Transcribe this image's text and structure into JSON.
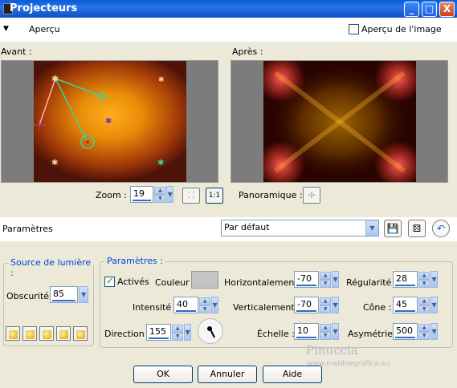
{
  "window": {
    "title": "Projecteurs",
    "minimize": "_",
    "maximize": "□",
    "close": "X"
  },
  "preview_bar": {
    "toggle_glyph": "▼",
    "label": "Aperçu",
    "apercu_image_label": "Aperçu de l'image"
  },
  "avant_label": "Avant :",
  "apres_label": "Après :",
  "zoom": {
    "label": "Zoom :",
    "value": "19",
    "fit_btn": "⛶",
    "one_to_one_btn": "1:1"
  },
  "panoramique": {
    "label": "Panoramique :",
    "glyph": "✢"
  },
  "parametres_row": {
    "label": "Paramètres",
    "preset": "Par défaut",
    "save_glyph": "💾",
    "dice_glyph": "⚄",
    "reset_glyph": "↶"
  },
  "source_lumiere": {
    "title": "Source de lumière :",
    "obscurite_label": "Obscurité :",
    "obscurite_value": "85"
  },
  "parametres_group": {
    "title": "Paramètres :",
    "actives_label": "Activés",
    "couleur_label": "Couleur :",
    "intensite_label": "Intensité :",
    "intensite_value": "40",
    "direction_label": "Direction :",
    "direction_value": "155",
    "horizontalement_label": "Horizontalement :",
    "horizontalement_value": "-70",
    "verticalement_label": "Verticalement :",
    "verticalement_value": "-70",
    "echelle_label": "Échelle :",
    "echelle_value": "10",
    "regularite_label": "Régularité :",
    "regularite_value": "28",
    "cone_label": "Cône :",
    "cone_value": "45",
    "asymetrie_label": "Asymétrie :",
    "asymetrie_value": "500",
    "color_swatch": "#c4c4c4"
  },
  "watermark": {
    "name": "Pinuccia",
    "site": "www.maidiregrafica.eu"
  },
  "buttons": {
    "ok": "OK",
    "annuler": "Annuler",
    "aide": "Aide"
  },
  "colors": {
    "accent_blue": "#0046d5",
    "title_bar": "#0a5cd8",
    "dialog_bg": "#ece9d8"
  }
}
